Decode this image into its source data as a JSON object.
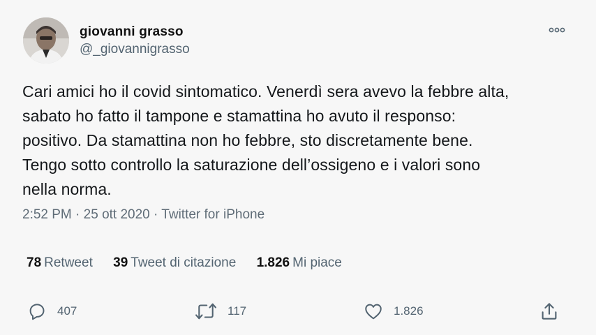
{
  "author": {
    "name": "giovanni grasso",
    "handle": "@_giovannigrasso"
  },
  "tweet": {
    "text": "Cari amici ho il covid sintomatico. Venerdì sera avevo la febbre alta,\nsabato ho fatto il tampone e stamattina ho avuto il responso:\npositivo. Da stamattina non ho febbre, sto discretamente bene.\nTengo sotto controllo la saturazione dell’ossigeno e i valori sono\nnella norma.",
    "time": "2:52 PM",
    "separator1": " · ",
    "date": "25 ott 2020",
    "separator2": " · ",
    "source": "Twitter for iPhone"
  },
  "stats": {
    "retweets_count": "78",
    "retweets_label": "Retweet",
    "quotes_count": "39",
    "quotes_label": "Tweet di citazione",
    "likes_count": "1.826",
    "likes_label": "Mi piace"
  },
  "actions": {
    "reply_count": "407",
    "retweet_count": "117",
    "like_count": "1.826"
  },
  "icons": {
    "reply": "reply-icon",
    "retweet": "retweet-icon",
    "like": "heart-icon",
    "share": "share-icon",
    "more": "more-icon"
  },
  "colors": {
    "background": "#f7f7f7",
    "text": "#14171a",
    "secondary": "#536471"
  }
}
